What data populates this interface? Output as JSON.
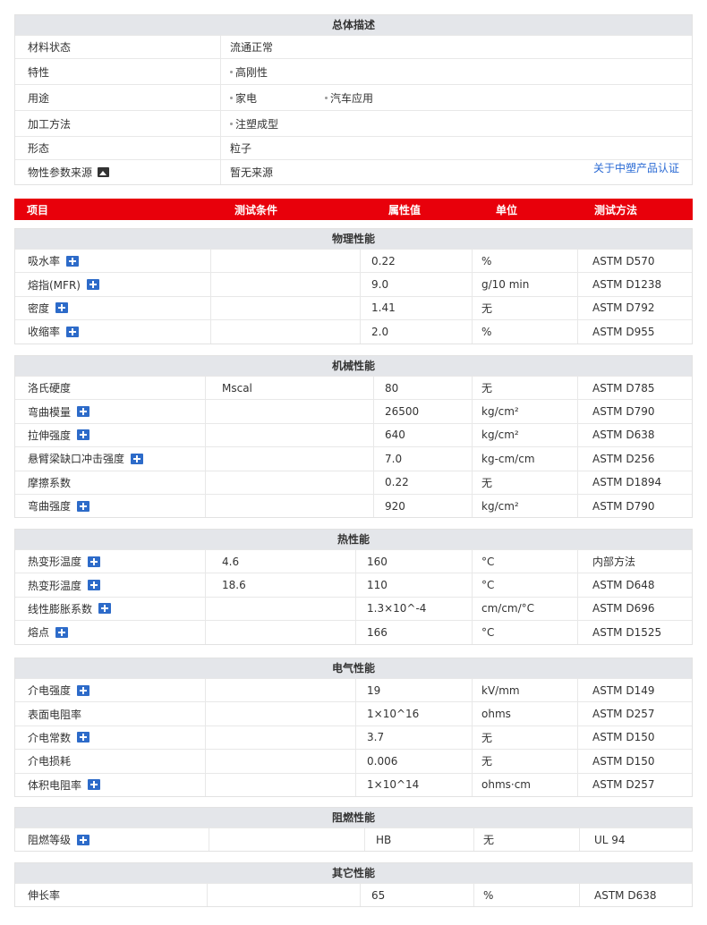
{
  "overview": {
    "title": "总体描述",
    "rows": [
      {
        "label": "材料状态",
        "values": [
          "流通正常"
        ],
        "bullets": false
      },
      {
        "label": "特性",
        "values": [
          "高刚性"
        ],
        "bullets": true
      },
      {
        "label": "用途",
        "values": [
          "家电",
          "汽车应用"
        ],
        "bullets": true
      },
      {
        "label": "加工方法",
        "values": [
          "注塑成型"
        ],
        "bullets": true
      },
      {
        "label": "形态",
        "values": [
          "粒子"
        ],
        "bullets": false
      },
      {
        "label": "物性参数来源",
        "values": [
          "暂无来源"
        ],
        "bullets": false
      }
    ],
    "cert_link": "关于中塑产品认证"
  },
  "columns": [
    "项目",
    "测试条件",
    "属性值",
    "单位",
    "测试方法"
  ],
  "sections": [
    {
      "title": "物理性能",
      "rows": [
        {
          "name": "吸水率",
          "plus": true,
          "cond": "",
          "value": "0.22",
          "unit": "%",
          "method": "ASTM D570"
        },
        {
          "name": "熔指(MFR)",
          "plus": true,
          "cond": "",
          "value": "9.0",
          "unit": "g/10 min",
          "method": "ASTM D1238"
        },
        {
          "name": "密度",
          "plus": true,
          "cond": "",
          "value": "1.41",
          "unit": "无",
          "method": "ASTM D792"
        },
        {
          "name": "收缩率",
          "plus": true,
          "cond": "",
          "value": "2.0",
          "unit": "%",
          "method": "ASTM D955"
        }
      ]
    },
    {
      "title": "机械性能",
      "rows": [
        {
          "name": "洛氏硬度",
          "plus": false,
          "cond": "Mscal",
          "value": "80",
          "unit": "无",
          "method": "ASTM D785"
        },
        {
          "name": "弯曲模量",
          "plus": true,
          "cond": "",
          "value": "26500",
          "unit": "kg/cm²",
          "method": "ASTM D790"
        },
        {
          "name": "拉伸强度",
          "plus": true,
          "cond": "",
          "value": "640",
          "unit": "kg/cm²",
          "method": "ASTM D638"
        },
        {
          "name": "悬臂梁缺口冲击强度",
          "plus": true,
          "cond": "",
          "value": "7.0",
          "unit": "kg-cm/cm",
          "method": "ASTM D256"
        },
        {
          "name": "摩擦系数",
          "plus": false,
          "cond": "",
          "value": "0.22",
          "unit": "无",
          "method": "ASTM D1894"
        },
        {
          "name": "弯曲强度",
          "plus": true,
          "cond": "",
          "value": "920",
          "unit": "kg/cm²",
          "method": "ASTM D790"
        }
      ]
    },
    {
      "title": "热性能",
      "rows": [
        {
          "name": "热变形温度",
          "plus": true,
          "cond": "4.6",
          "value": "160",
          "unit": "°C",
          "method": "内部方法"
        },
        {
          "name": "热变形温度",
          "plus": true,
          "cond": "18.6",
          "value": "110",
          "unit": "°C",
          "method": "ASTM D648"
        },
        {
          "name": "线性膨胀系数",
          "plus": true,
          "cond": "",
          "value": "1.3×10^-4",
          "unit": "cm/cm/°C",
          "method": "ASTM D696"
        },
        {
          "name": "熔点",
          "plus": true,
          "cond": "",
          "value": "166",
          "unit": "°C",
          "method": "ASTM D1525"
        }
      ]
    },
    {
      "title": "电气性能",
      "rows": [
        {
          "name": "介电强度",
          "plus": true,
          "cond": "",
          "value": "19",
          "unit": "kV/mm",
          "method": "ASTM D149"
        },
        {
          "name": "表面电阻率",
          "plus": false,
          "cond": "",
          "value": "1×10^16",
          "unit": "ohms",
          "method": "ASTM D257"
        },
        {
          "name": "介电常数",
          "plus": true,
          "cond": "",
          "value": "3.7",
          "unit": "无",
          "method": "ASTM D150"
        },
        {
          "name": "介电损耗",
          "plus": false,
          "cond": "",
          "value": "0.006",
          "unit": "无",
          "method": "ASTM D150"
        },
        {
          "name": "体积电阻率",
          "plus": true,
          "cond": "",
          "value": "1×10^14",
          "unit": "ohms·cm",
          "method": "ASTM D257"
        }
      ]
    },
    {
      "title": "阻燃性能",
      "rows": [
        {
          "name": "阻燃等级",
          "plus": true,
          "cond": "",
          "value": "HB",
          "unit": "无",
          "method": "UL 94"
        }
      ]
    },
    {
      "title": "其它性能",
      "rows": [
        {
          "name": "伸长率",
          "plus": false,
          "cond": "",
          "value": "65",
          "unit": "%",
          "method": "ASTM D638"
        }
      ]
    }
  ]
}
